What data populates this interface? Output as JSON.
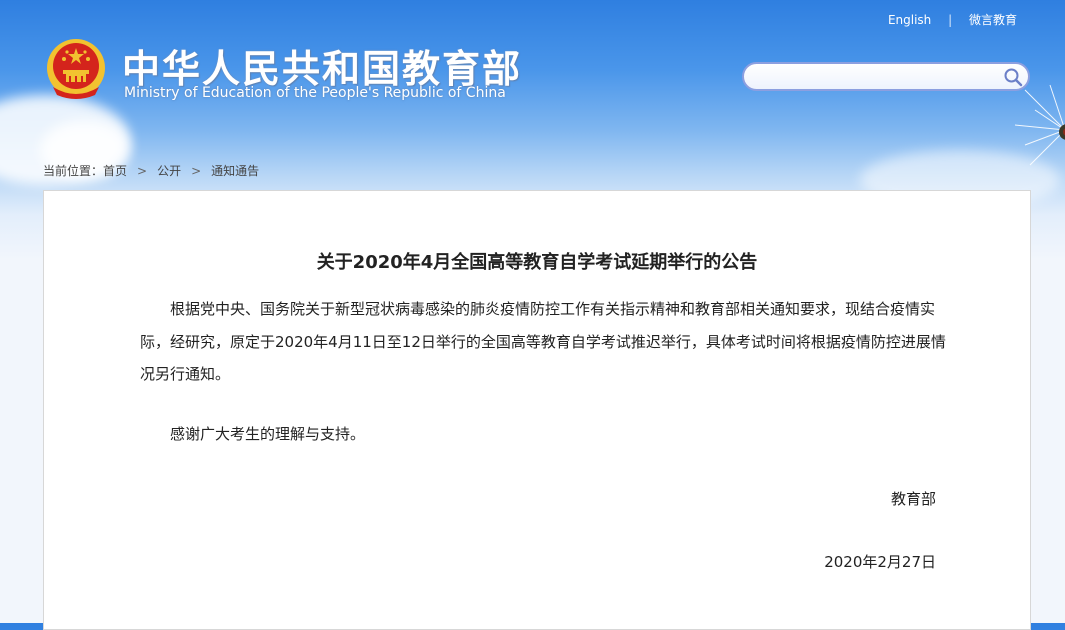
{
  "header": {
    "title_cn": "中华人民共和国教育部",
    "title_en": "Ministry of Education of the People's Republic of China",
    "links": {
      "english": "English",
      "separator": "|",
      "weibo": "微言教育"
    },
    "search": {
      "placeholder": "",
      "value": ""
    }
  },
  "breadcrumb": {
    "prefix": "当前位置：",
    "items": [
      "首页",
      "公开",
      "通知通告"
    ]
  },
  "article": {
    "title": "关于2020年4月全国高等教育自学考试延期举行的公告",
    "paragraph": "根据党中央、国务院关于新型冠状病毒感染的肺炎疫情防控工作有关指示精神和教育部相关通知要求，现结合疫情实际，经研究，原定于2020年4月11日至12日举行的全国高等教育自学考试推迟举行，具体考试时间将根据疫情防控进展情况另行通知。",
    "thanks": "感谢广大考生的理解与支持。",
    "signature": "教育部",
    "date": "2020年2月27日"
  },
  "colors": {
    "sky_top": "#2f7fe0",
    "search_border": "#8c9fe0",
    "emblem_red": "#d4241c",
    "emblem_gold": "#f2c230"
  },
  "icons": {
    "emblem": "national-emblem-icon",
    "search": "search-icon",
    "chevron": "chevron-right-icon"
  }
}
